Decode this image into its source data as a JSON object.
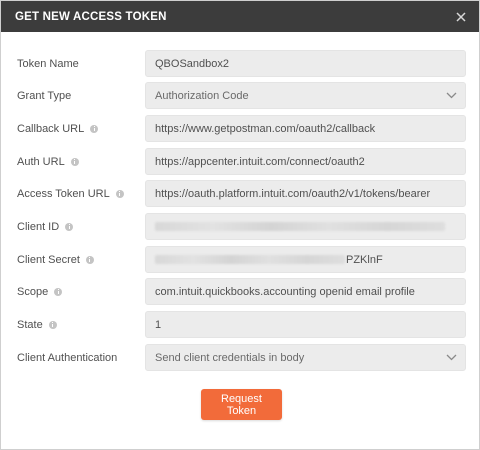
{
  "dialog": {
    "title": "GET NEW ACCESS TOKEN"
  },
  "fields": {
    "token_name": {
      "label": "Token Name",
      "value": "QBOSandbox2"
    },
    "grant_type": {
      "label": "Grant Type",
      "value": "Authorization Code"
    },
    "callback_url": {
      "label": "Callback URL",
      "value": "https://www.getpostman.com/oauth2/callback"
    },
    "auth_url": {
      "label": "Auth URL",
      "value": "https://appcenter.intuit.com/connect/oauth2"
    },
    "access_token_url": {
      "label": "Access Token URL",
      "value": "https://oauth.platform.intuit.com/oauth2/v1/tokens/bearer"
    },
    "client_id": {
      "label": "Client ID",
      "value": ""
    },
    "client_secret": {
      "label": "Client Secret",
      "value": "PZKlnF"
    },
    "scope": {
      "label": "Scope",
      "value": "com.intuit.quickbooks.accounting openid email profile"
    },
    "state": {
      "label": "State",
      "value": "1"
    },
    "client_authentication": {
      "label": "Client Authentication",
      "value": "Send client credentials in body"
    }
  },
  "actions": {
    "request_token_label": "Request Token"
  },
  "colors": {
    "titlebar": "#3c3c3c",
    "field_bg": "#ececec",
    "accent_button": "#f26b3a"
  },
  "icons": {
    "close": "close-icon",
    "info": "info-icon",
    "dropdown": "chevron-down-icon"
  }
}
